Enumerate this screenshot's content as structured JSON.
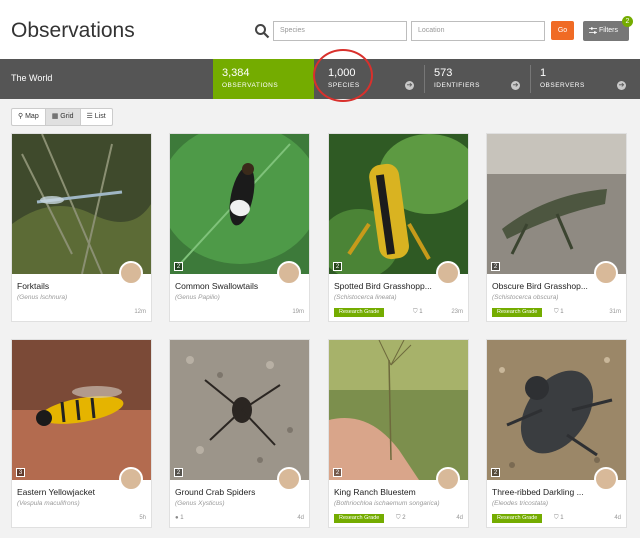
{
  "header": {
    "title": "Observations",
    "species_placeholder": "Species",
    "location_placeholder": "Location",
    "go_label": "Go",
    "filters_label": "Filters",
    "filters_count": "2"
  },
  "stats": {
    "place": "The World",
    "observations": {
      "value": "3,384",
      "label": "OBSERVATIONS"
    },
    "species": {
      "value": "1,000",
      "label": "SPECIES"
    },
    "identifiers": {
      "value": "573",
      "label": "IDENTIFIERS"
    },
    "observers": {
      "value": "1",
      "label": "OBSERVERS"
    }
  },
  "views": {
    "map": "Map",
    "grid": "Grid",
    "list": "List",
    "active": "Grid"
  },
  "cards": [
    {
      "name": "Forktails",
      "sci": "(Genus Ischnura)",
      "grade": "",
      "ids": "",
      "time": "12m",
      "type_icon": "camera-icon"
    },
    {
      "name": "Common Swallowtails",
      "sci": "(Genus Papilio)",
      "grade": "",
      "ids": "",
      "time": "19m",
      "type_icon": "camera-icon"
    },
    {
      "name": "Spotted Bird Grasshopp...",
      "sci": "(Schistocerca lineata)",
      "grade": "Research Grade",
      "ids": "1",
      "time": "23m",
      "type_icon": "camera-icon"
    },
    {
      "name": "Obscure Bird Grasshop...",
      "sci": "(Schistocerca obscura)",
      "grade": "Research Grade",
      "ids": "1",
      "time": "31m",
      "type_icon": "camera-icon"
    },
    {
      "name": "Eastern Yellowjacket",
      "sci": "(Vespula maculifrons)",
      "grade": "",
      "ids": "",
      "time": "5h",
      "type_icon": "camera-icon"
    },
    {
      "name": "Ground Crab Spiders",
      "sci": "(Genus Xysticus)",
      "grade": "",
      "ids": "1",
      "time": "4d",
      "type_icon": "camera-icon"
    },
    {
      "name": "King Ranch Bluestem",
      "sci": "(Bothriochloa ischaemum songarica)",
      "grade": "Research Grade",
      "ids": "2",
      "time": "4d",
      "type_icon": "camera-icon"
    },
    {
      "name": "Three-ribbed Darkling ...",
      "sci": "(Eleodes tricostata)",
      "grade": "Research Grade",
      "ids": "1",
      "time": "4d",
      "type_icon": "camera-icon"
    }
  ],
  "colors": {
    "accent": "#74ac00",
    "go": "#f06b25",
    "highlight": "#d9302c"
  }
}
